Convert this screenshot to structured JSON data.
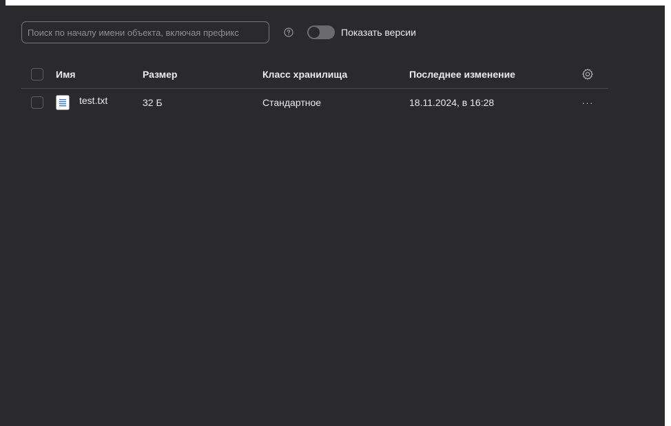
{
  "toolbar": {
    "search_placeholder": "Поиск по началу имени объекта, включая префикс",
    "search_value": "",
    "help_icon": "question-circle-icon",
    "show_versions_label": "Показать версии",
    "show_versions_enabled": false
  },
  "table": {
    "columns": {
      "name": "Имя",
      "size": "Размер",
      "storage_class": "Класс хранилища",
      "modified": "Последнее изменение"
    },
    "settings_icon": "gear-icon",
    "rows": [
      {
        "name": "test.txt",
        "size": "32 Б",
        "storage_class": "Стандартное",
        "modified": "18.11.2024, в 16:28",
        "icon": "text-file-icon",
        "actions_label": "···"
      }
    ]
  },
  "colors": {
    "background": "#2a2a2c",
    "text": "#ececee",
    "divider": "#48484c",
    "file_icon": "#3a7bd5"
  }
}
